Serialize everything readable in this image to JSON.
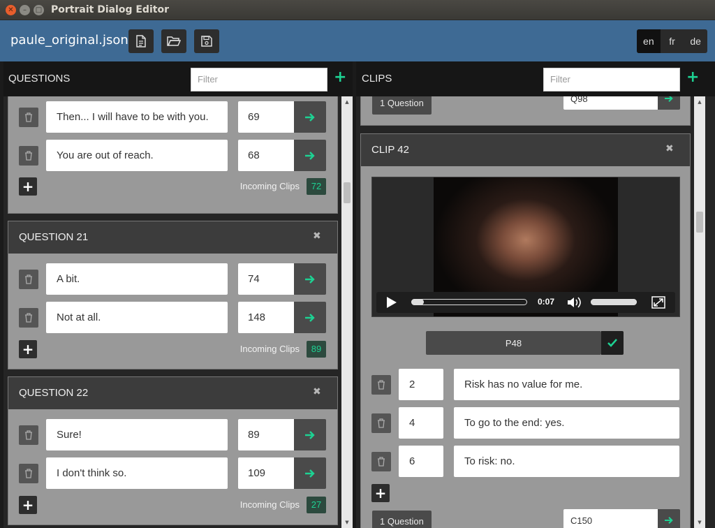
{
  "window": {
    "title": "Portrait Dialog Editor"
  },
  "header": {
    "filename": "paule_original.json",
    "languages": [
      "en",
      "fr",
      "de"
    ],
    "active_language": "en"
  },
  "colors": {
    "accent": "#1dd293",
    "appbar": "#3e6a94"
  },
  "questions": {
    "title": "QUESTIONS",
    "filter_placeholder": "Filter",
    "top_card": {
      "answers": [
        {
          "text": "Then... I will have to be with you.",
          "target": "69"
        },
        {
          "text": "You are out of reach.",
          "target": "68"
        }
      ],
      "incoming_label": "Incoming Clips",
      "incoming_count": "72"
    },
    "cards": [
      {
        "title": "QUESTION 21",
        "answers": [
          {
            "text": "A bit.",
            "target": "74"
          },
          {
            "text": "Not at all.",
            "target": "148"
          }
        ],
        "incoming_label": "Incoming Clips",
        "incoming_count": "89"
      },
      {
        "title": "QUESTION 22",
        "answers": [
          {
            "text": "Sure!",
            "target": "89"
          },
          {
            "text": "I don't think so.",
            "target": "109"
          }
        ],
        "incoming_label": "Incoming Clips",
        "incoming_count": "27"
      }
    ]
  },
  "clips": {
    "title": "CLIPS",
    "filter_placeholder": "Filter",
    "top_card": {
      "question_tag": "1 Question",
      "next": "Q98"
    },
    "card": {
      "title": "CLIP 42",
      "video": {
        "time": "0:07",
        "progress": 0.05,
        "volume": 1.0
      },
      "portrait_code": "P48",
      "options": [
        {
          "number": "2",
          "text": "Risk has no value for me."
        },
        {
          "number": "4",
          "text": "To go to the end:  yes."
        },
        {
          "number": "6",
          "text": "To risk: no."
        }
      ],
      "question_tag": "1 Question",
      "next": "C150"
    }
  }
}
